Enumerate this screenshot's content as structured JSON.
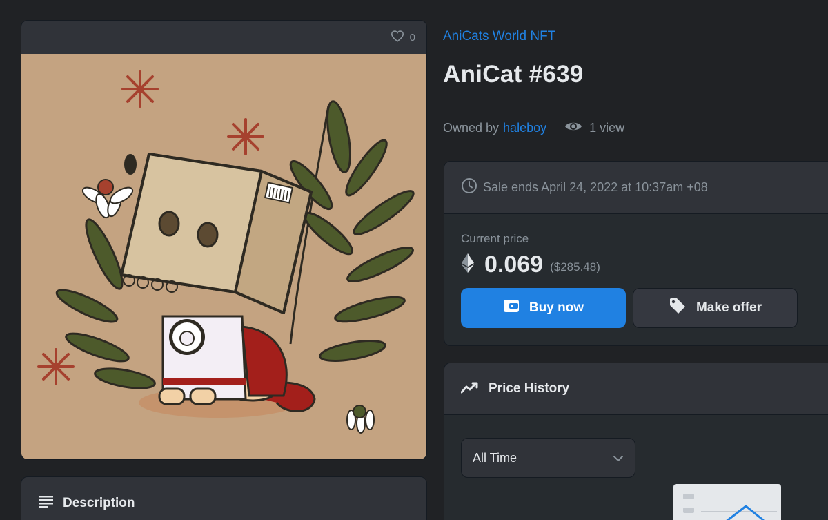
{
  "media": {
    "favorite_count": "0",
    "image_alt": "AniCat #639 artwork"
  },
  "item": {
    "collection_name": "AniCats World NFT",
    "title": "AniCat #639",
    "owned_by_label": "Owned by",
    "owner": "haleboy",
    "views": "1 view"
  },
  "sale": {
    "ends_text": "Sale ends April 24, 2022 at 10:37am +08",
    "current_price_label": "Current price",
    "price_eth": "0.069",
    "price_usd": "($285.48)",
    "buy_label": "Buy now",
    "offer_label": "Make offer"
  },
  "price_history": {
    "title": "Price History",
    "range_selected": "All Time"
  },
  "description": {
    "title": "Description"
  },
  "colors": {
    "accent": "#2081e2",
    "background": "#202225",
    "panel": "#303339",
    "text": "#e5e8eb",
    "muted": "#8a939b"
  },
  "icons": {
    "favorite": "heart-icon",
    "views": "eye-icon",
    "sale_timer": "clock-icon",
    "currency": "ethereum-icon",
    "buy": "wallet-icon",
    "offer": "tag-icon",
    "price_history": "trending-line-icon",
    "dropdown": "chevron-down-icon",
    "description": "list-icon"
  }
}
